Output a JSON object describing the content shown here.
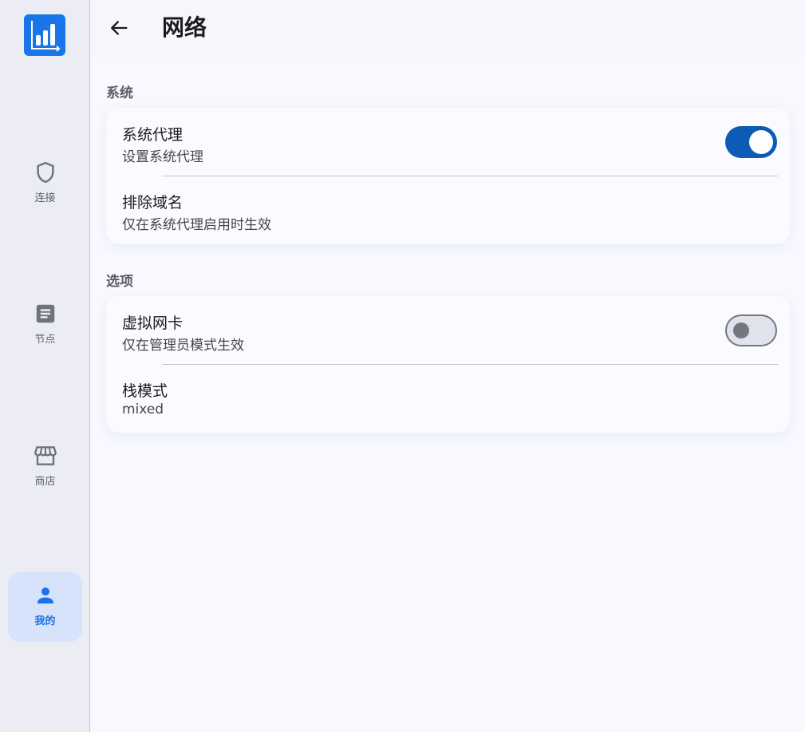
{
  "colors": {
    "accent": "#1976e8",
    "toggle_on": "#0d5bb5",
    "nav_active_bg": "#d6e3fb",
    "nav_icon": "#70737f"
  },
  "nav": {
    "logo_icon": "bar-chart-logo-icon",
    "items": [
      {
        "label": "连接",
        "icon": "shield-icon",
        "active": false
      },
      {
        "label": "节点",
        "icon": "document-icon",
        "active": false
      },
      {
        "label": "商店",
        "icon": "store-icon",
        "active": false
      },
      {
        "label": "我的",
        "icon": "person-icon",
        "active": true
      }
    ]
  },
  "header": {
    "back_icon": "arrow-back-icon",
    "title": "网络"
  },
  "sections": {
    "system": {
      "title": "系统",
      "system_proxy": {
        "title": "系统代理",
        "subtitle": "设置系统代理",
        "enabled": true
      },
      "exclude_domains": {
        "title": "排除域名",
        "subtitle": "仅在系统代理启用时生效"
      }
    },
    "options": {
      "title": "选项",
      "virtual_nic": {
        "title": "虚拟网卡",
        "subtitle": "仅在管理员模式生效",
        "enabled": false
      },
      "stack_mode": {
        "title": "栈模式",
        "subtitle": "mixed"
      }
    }
  }
}
